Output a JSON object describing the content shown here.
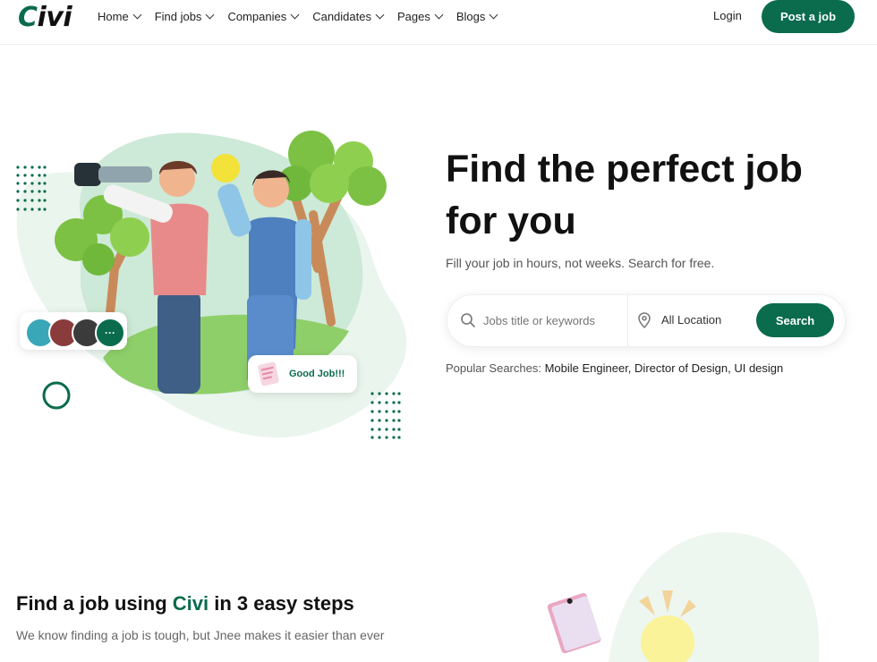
{
  "brand": {
    "logo_first": "C",
    "logo_rest": "ivi"
  },
  "nav": {
    "items": [
      {
        "label": "Home"
      },
      {
        "label": "Find jobs"
      },
      {
        "label": "Companies"
      },
      {
        "label": "Candidates"
      },
      {
        "label": "Pages"
      },
      {
        "label": "Blogs"
      }
    ],
    "login_label": "Login",
    "post_job_label": "Post a job"
  },
  "hero": {
    "title": "Find the perfect job for you",
    "subtitle": "Fill your job in hours, not weeks. Search for free.",
    "search": {
      "keyword_placeholder": "Jobs title or keywords",
      "location_value": "All Location",
      "button_label": "Search"
    },
    "popular": {
      "label": "Popular Searches:",
      "terms": [
        "Mobile Engineer,",
        "Director of Design,",
        "UI design"
      ]
    },
    "illustration": {
      "more_label": "···",
      "good_job_label": "Good Job!!!"
    }
  },
  "steps": {
    "title_part1": "Find a job using ",
    "title_brand": "Civi",
    "title_part2": " in 3 easy steps",
    "subtitle": "We know finding a job is tough, but Jnee makes it easier than ever"
  },
  "colors": {
    "accent": "#0a6b4d",
    "light_green": "#dff0e6",
    "text_dark": "#111111"
  }
}
